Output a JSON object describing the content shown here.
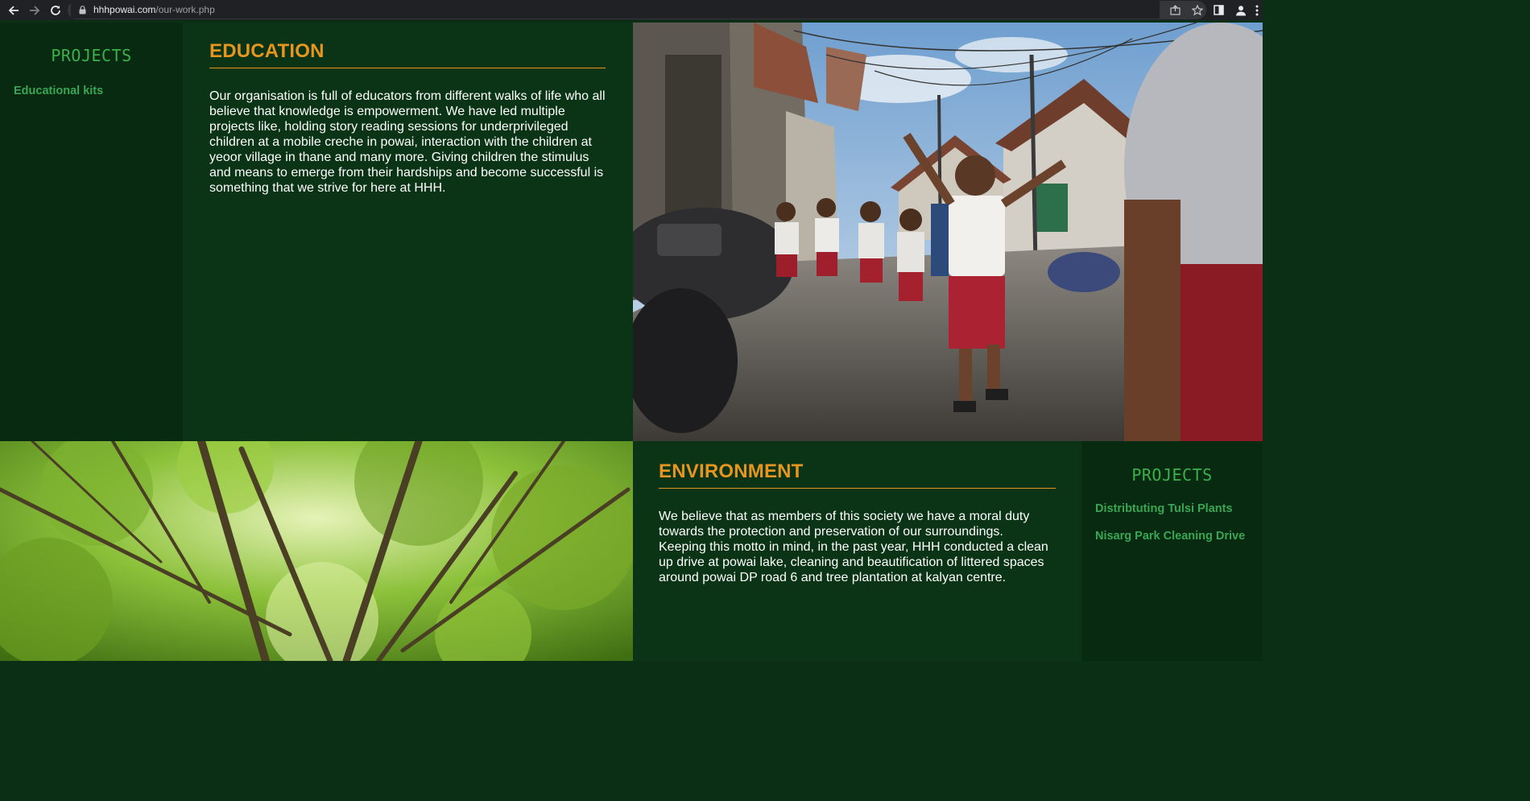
{
  "browser": {
    "url_host": "hhhpowai.com",
    "url_path": "/our-work.php"
  },
  "education": {
    "sidebar_heading": "PROJECTS",
    "projects": [
      "Educational kits"
    ],
    "title": "EDUCATION",
    "body": "Our organisation is full of educators from different walks of life who all believe that knowledge is empowerment. We have led multiple projects like, holding story reading sessions for underprivileged children at a mobile creche in powai, interaction with the children at yeoor village in thane and many more. Giving children the stimulus and means to emerge from their hardships and become successful is something that we strive for here at HHH."
  },
  "environment": {
    "title": "ENVIRONMENT",
    "body": "We believe that as members of this society we have a moral duty towards the protection and preservation of our surroundings. Keeping this motto in mind, in the past year, HHH conducted a clean up drive at powai lake, cleaning and beautification of littered spaces around powai DP road 6 and tree plantation at kalyan centre.",
    "sidebar_heading": "PROJECTS",
    "projects": [
      "Distribtuting Tulsi Plants",
      "Nisarg Park Cleaning Drive"
    ]
  },
  "colors": {
    "accent_orange": "#e6951f",
    "link_green": "#3aa655",
    "heading_green": "#3bb04d",
    "panel_dark": "#072a10",
    "panel_main": "#0a3415"
  },
  "icons": {
    "back": "arrow-left-icon",
    "forward": "arrow-right-icon",
    "reload": "reload-icon",
    "lock": "lock-icon",
    "share": "share-icon",
    "bookmark": "star-icon",
    "side_panel": "side-panel-icon",
    "profile": "profile-icon",
    "menu": "kebab-menu-icon"
  },
  "images": {
    "education": "schoolchildren-walking-street-photo",
    "environment": "forest-canopy-photo"
  }
}
